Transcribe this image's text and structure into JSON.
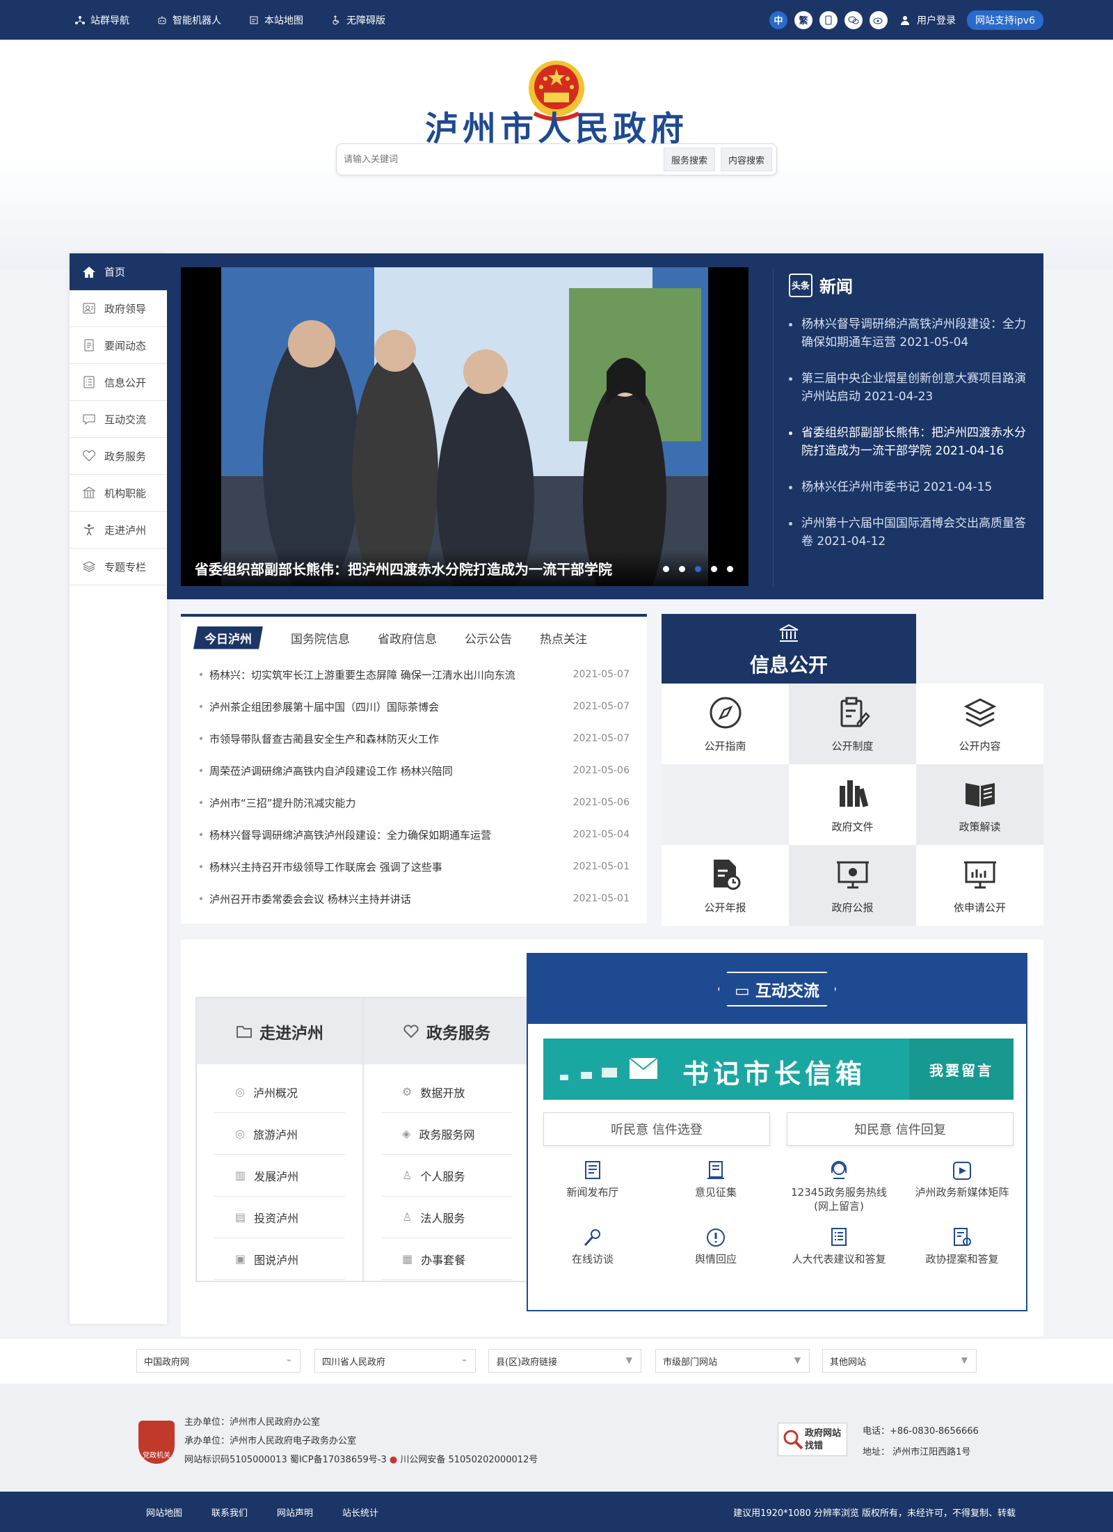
{
  "topbar": {
    "items": [
      "站群导航",
      "智能机器人",
      "本站地图",
      "无障碍版"
    ],
    "lang_cn": "中",
    "lang_tw": "繁",
    "login": "用户登录",
    "ipv6": "网站支持ipv6"
  },
  "header": {
    "title": "泸州市人民政府",
    "url": "www.luzhou.gov.cn"
  },
  "search": {
    "placeholder": "请输入关键词",
    "btn_service": "服务搜索",
    "btn_content": "内容搜索"
  },
  "sidebar": {
    "items": [
      {
        "label": "首页",
        "icon": "home-icon"
      },
      {
        "label": "政府领导",
        "icon": "leader-icon"
      },
      {
        "label": "要闻动态",
        "icon": "news-icon"
      },
      {
        "label": "信息公开",
        "icon": "list-icon"
      },
      {
        "label": "互动交流",
        "icon": "chat-icon"
      },
      {
        "label": "政务服务",
        "icon": "heart-icon"
      },
      {
        "label": "机构职能",
        "icon": "building-icon"
      },
      {
        "label": "走进泸州",
        "icon": "person-icon"
      },
      {
        "label": "专题专栏",
        "icon": "layers-icon"
      }
    ]
  },
  "banner": {
    "caption": "省委组织部副部长熊伟：把泸州四渡赤水分院打造成为一流干部学院",
    "slides": 5,
    "active_slide": 3
  },
  "news": {
    "tag": "头条",
    "title": "新闻",
    "items": [
      "杨林兴督导调研绵泸高铁泸州段建设：全力确保如期通车运营 2021-05-04",
      "第三届中央企业熠星创新创意大赛项目路演泸州站启动 2021-04-23",
      "省委组织部副部长熊伟：把泸州四渡赤水分院打造成为一流干部学院 2021-04-16",
      "杨林兴任泸州市委书记 2021-04-15",
      "泸州第十六届中国国际酒博会交出高质量答卷 2021-04-12"
    ]
  },
  "tabs": {
    "labels": [
      "今日泸州",
      "国务院信息",
      "省政府信息",
      "公示公告",
      "热点关注"
    ],
    "rows": [
      {
        "title": "杨林兴：切实筑牢长江上游重要生态屏障 确保一江清水出川向东流",
        "date": "2021-05-07"
      },
      {
        "title": "泸州茶企组团参展第十届中国（四川）国际茶博会",
        "date": "2021-05-07"
      },
      {
        "title": "市领导带队督查古蔺县安全生产和森林防灭火工作",
        "date": "2021-05-07"
      },
      {
        "title": "周荣莅泸调研绵泸高铁内自泸段建设工作 杨林兴陪同",
        "date": "2021-05-06"
      },
      {
        "title": "泸州市“三招”提升防汛减灾能力",
        "date": "2021-05-06"
      },
      {
        "title": "杨林兴督导调研绵泸高铁泸州段建设：全力确保如期通车运营",
        "date": "2021-05-04"
      },
      {
        "title": "杨林兴主持召开市级领导工作联席会 强调了这些事",
        "date": "2021-05-01"
      },
      {
        "title": "泸州召开市委常委会会议 杨林兴主持并讲话",
        "date": "2021-05-01"
      }
    ]
  },
  "xxgk": {
    "title": "信息公开",
    "items": [
      {
        "label": "公开指南",
        "icon": "compass-icon"
      },
      {
        "label": "公开制度",
        "icon": "clipboard-icon"
      },
      {
        "label": "公开内容",
        "icon": "stack-icon"
      },
      {
        "label": "政府文件",
        "icon": "books-icon"
      },
      {
        "label": "政策解读",
        "icon": "open-book-icon"
      },
      {
        "label": "公开年报",
        "icon": "report-icon"
      },
      {
        "label": "政府公报",
        "icon": "bulletin-icon"
      },
      {
        "label": "依申请公开",
        "icon": "presentation-icon"
      }
    ]
  },
  "zjlz": {
    "title": "走进泸州",
    "items": [
      "泸州概况",
      "旅游泸州",
      "发展泸州",
      "投资泸州",
      "图说泸州"
    ]
  },
  "zwfw": {
    "title": "政务服务",
    "items": [
      "数据开放",
      "政务服务网",
      "个人服务",
      "法人服务",
      "办事套餐"
    ]
  },
  "hdjl": {
    "title": "互动交流",
    "mailbox": "书记市长信箱",
    "leave_msg": "我要留言",
    "btn_listen": "听民意 信件选登",
    "btn_know": "知民意 信件回复",
    "items": [
      {
        "label": "新闻发布厅",
        "icon": "press-icon"
      },
      {
        "label": "意见征集",
        "icon": "survey-icon"
      },
      {
        "label": "12345政务服务热线(网上留言)",
        "icon": "hotline-icon"
      },
      {
        "label": "泸州政务新媒体矩阵",
        "icon": "media-icon"
      },
      {
        "label": "在线访谈",
        "icon": "mic-icon"
      },
      {
        "label": "舆情回应",
        "icon": "alert-icon"
      },
      {
        "label": "人大代表建议和答复",
        "icon": "doc-icon"
      },
      {
        "label": "政协提案和答复",
        "icon": "proposal-icon"
      }
    ]
  },
  "links": [
    "中国政府网",
    "四川省人民政府",
    "县(区)政府链接",
    "市级部门网站",
    "其他网站"
  ],
  "footer": {
    "sponsor": "主办单位：泸州市人民政府办公室",
    "organizer": "承办单位：泸州市人民政府电子政务办公室",
    "ids": "网站标识码5105000013 蜀ICP备17038659号-3",
    "police": "川公网安备 51050202000012号",
    "badge": "党政机关",
    "jiucuo": "政府网站 找错",
    "phone": "电话：+86-0830-8656666",
    "address": "地址： 泸州市江阳西路1号"
  },
  "bottom": {
    "nav": [
      "网站地图",
      "联系我们",
      "网站声明",
      "站长统计"
    ],
    "copyright": "建议用1920*1080 分辨率浏览 版权所有，未经许可，不得复制、转载"
  },
  "colors": {
    "primary": "#1b3566",
    "accent": "#2a6ac9",
    "teal": "#1aa7a2"
  }
}
